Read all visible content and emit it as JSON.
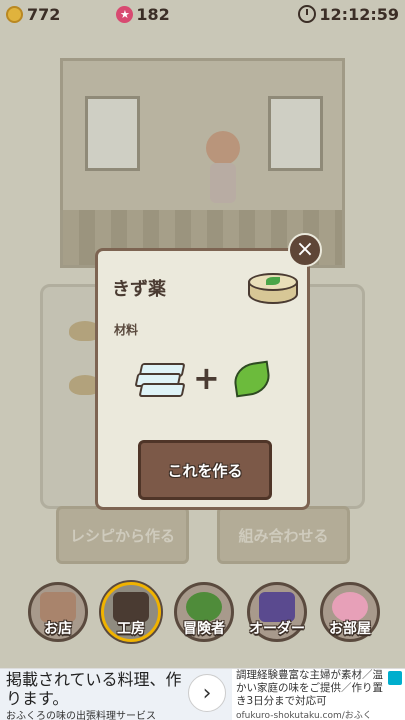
{
  "status": {
    "coins": "772",
    "gems": "182",
    "time": "12:12:59"
  },
  "panel_buttons": {
    "recipe": "レシピから作る",
    "combine": "組み合わせる"
  },
  "modal": {
    "title": "きず薬",
    "materials_label": "材料",
    "plus": "+",
    "craft_button": "これを作る",
    "close": "×",
    "materials": [
      "ice-crystal-icon",
      "green-leaf-icon"
    ],
    "result_icon": "salve-tin-icon"
  },
  "nav": {
    "items": [
      {
        "label": "お店",
        "icon": "shop-house-icon"
      },
      {
        "label": "工房",
        "icon": "workshop-tools-icon",
        "active": true
      },
      {
        "label": "冒険者",
        "icon": "forest-tree-icon"
      },
      {
        "label": "オーダー",
        "icon": "order-book-icon"
      },
      {
        "label": "お部屋",
        "icon": "room-flower-vase-icon"
      }
    ]
  },
  "ad": {
    "headline": "掲載されている料理、作ります。",
    "sub": "おふくろの味の出張料理サービス",
    "right_text": "調理経験豊富な主婦が素材／温かい家庭の味をご提供／作り置き3日分まで対応可",
    "url": "ofukuro-shokutaku.com/おふく",
    "arrow": "›"
  },
  "colors": {
    "accent": "#f0b300",
    "button_brown": "#7c5948",
    "modal_bg": "#ebe9dc"
  }
}
